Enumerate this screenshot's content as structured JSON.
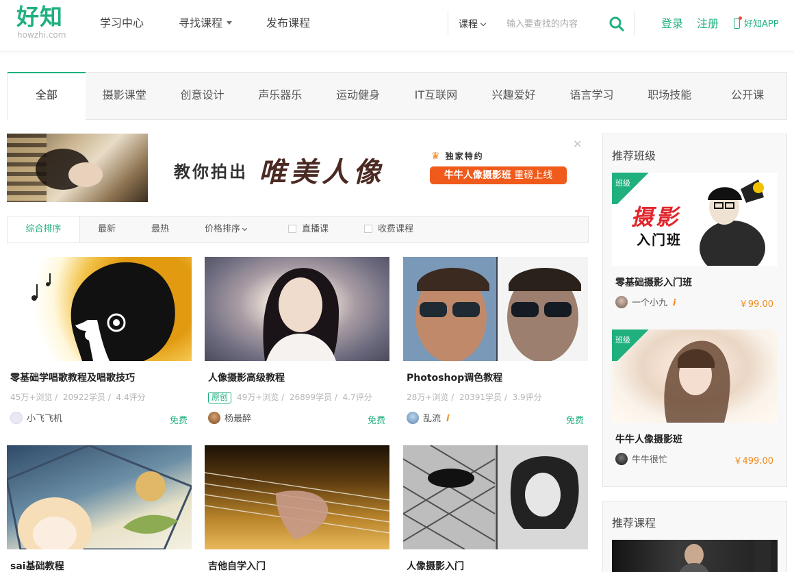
{
  "header": {
    "logo_main": "好知",
    "logo_sub": "howzhi.com",
    "nav": [
      {
        "label": "学习中心"
      },
      {
        "label": "寻找课程"
      },
      {
        "label": "发布课程"
      }
    ],
    "search_type": "课程",
    "search_placeholder": "输入要查找的内容",
    "login": "登录",
    "register": "注册",
    "app": "好知APP",
    "brand_color": "#1fb07e"
  },
  "categories": {
    "active_index": 0,
    "items": [
      "全部",
      "摄影课堂",
      "创意设计",
      "声乐器乐",
      "运动健身",
      "IT互联网",
      "兴趣爱好",
      "语言学习",
      "职场技能",
      "公开课"
    ]
  },
  "banner": {
    "text1": "教你拍出",
    "text2": "唯美人像",
    "exclusive": "独家特约",
    "pill_strong": "牛牛人像摄影班",
    "pill_rest": "重磅上线",
    "close": "×"
  },
  "filters": {
    "comprehensive": "综合排序",
    "newest": "最新",
    "hottest": "最热",
    "price": "价格排序",
    "live": "直播课",
    "paid": "收费课程"
  },
  "courses": [
    {
      "title": "零基础学唱歌教程及唱歌技巧",
      "tag": "",
      "views": "45万+浏览",
      "students": "20922学员",
      "rating": "4.4评分",
      "author": "小飞飞机",
      "price": "免费"
    },
    {
      "title": "人像摄影高级教程",
      "tag": "原创",
      "views": "49万+浏览",
      "students": "26899学员",
      "rating": "4.7评分",
      "author": "杨最醉",
      "price": "免费"
    },
    {
      "title": "Photoshop调色教程",
      "tag": "",
      "views": "28万+浏览",
      "students": "20391学员",
      "rating": "3.9评分",
      "author": "乱流",
      "price": "免费"
    },
    {
      "title": "sai基础教程"
    },
    {
      "title": "吉他自学入门"
    },
    {
      "title": "人像摄影入门"
    }
  ],
  "sidebar": {
    "classes_title": "推荐班级",
    "classes": [
      {
        "ribbon": "班级",
        "name": "零基础摄影入门班",
        "author": "一个小九",
        "price": "￥99.00",
        "thumb_text_1": "摄影",
        "thumb_text_2": "入门班"
      },
      {
        "ribbon": "班级",
        "name": "牛牛人像摄影班",
        "author": "牛牛很忙",
        "price": "￥499.00"
      }
    ],
    "courses_title": "推荐课程"
  }
}
